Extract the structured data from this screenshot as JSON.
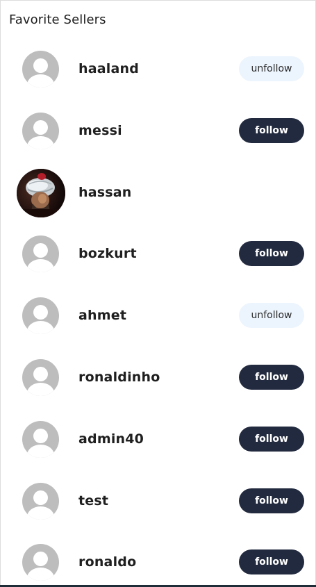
{
  "title": "Favorite Sellers",
  "sellers": [
    {
      "name": "haaland",
      "button": "unfollow",
      "button_style": "unfollow",
      "avatar": "default-avatar-icon"
    },
    {
      "name": "messi",
      "button": "follow",
      "button_style": "follow",
      "avatar": "default-avatar-icon"
    },
    {
      "name": "hassan",
      "button": "",
      "button_style": "",
      "avatar": "profile-photo"
    },
    {
      "name": "bozkurt",
      "button": "follow",
      "button_style": "follow",
      "avatar": "default-avatar-icon"
    },
    {
      "name": "ahmet",
      "button": "unfollow",
      "button_style": "unfollow",
      "avatar": "default-avatar-icon"
    },
    {
      "name": "ronaldinho",
      "button": "follow",
      "button_style": "follow",
      "avatar": "default-avatar-icon"
    },
    {
      "name": "admin40",
      "button": "follow",
      "button_style": "follow",
      "avatar": "default-avatar-icon"
    },
    {
      "name": "test",
      "button": "follow",
      "button_style": "follow",
      "avatar": "default-avatar-icon"
    },
    {
      "name": "ronaldo",
      "button": "follow",
      "button_style": "follow",
      "avatar": "default-avatar-icon"
    }
  ],
  "colors": {
    "follow_bg": "#222a3f",
    "unfollow_bg": "#ecf4fd",
    "avatar_bg": "#bdbdbd"
  }
}
